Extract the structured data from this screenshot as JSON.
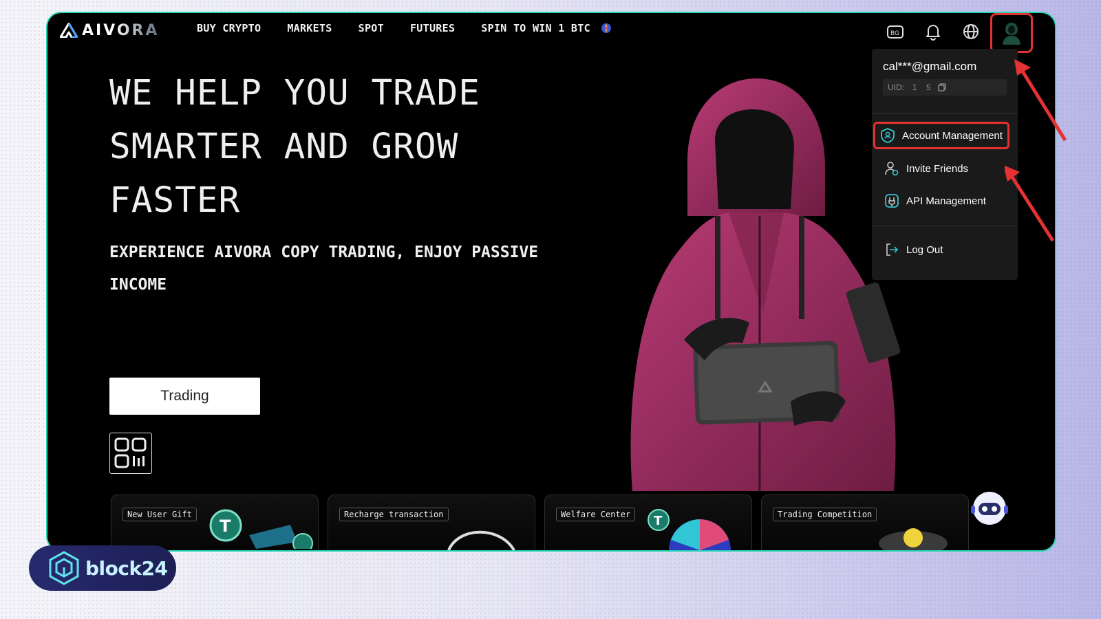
{
  "brand": {
    "logo_text": "AIVORA"
  },
  "nav": {
    "items": [
      "BUY CRYPTO",
      "MARKETS",
      "SPOT",
      "FUTURES",
      "SPIN TO WIN 1 BTC"
    ]
  },
  "hero": {
    "title": "WE HELP YOU TRADE SMARTER AND GROW FASTER",
    "subtitle": "EXPERIENCE AIVORA COPY TRADING, ENJOY PASSIVE INCOME",
    "cta": "Trading"
  },
  "account_menu": {
    "email": "cal***@gmail.com",
    "uid_label": "UID:",
    "uid_value": "1    5",
    "items": [
      "Account Management",
      "Invite Friends",
      "API Management",
      "Log Out"
    ],
    "highlighted": "Account Management"
  },
  "cards": [
    "New User Gift",
    "Recharge transaction",
    "Welfare Center",
    "Trading Competition"
  ],
  "watermark": {
    "text": "block24"
  },
  "colors": {
    "frame_border": "#24d6b4",
    "annotation_red": "#e53232",
    "jacket": "#9b2f62",
    "icon_teal": "#36c5d0"
  },
  "icons": [
    "aivora-logo",
    "gift-box-icon",
    "bell-icon",
    "globe-icon",
    "avatar-icon",
    "copy-icon",
    "shield-user-icon",
    "invite-user-icon",
    "api-icon",
    "logout-icon",
    "qr-code-icon",
    "robot-assistant-icon"
  ]
}
